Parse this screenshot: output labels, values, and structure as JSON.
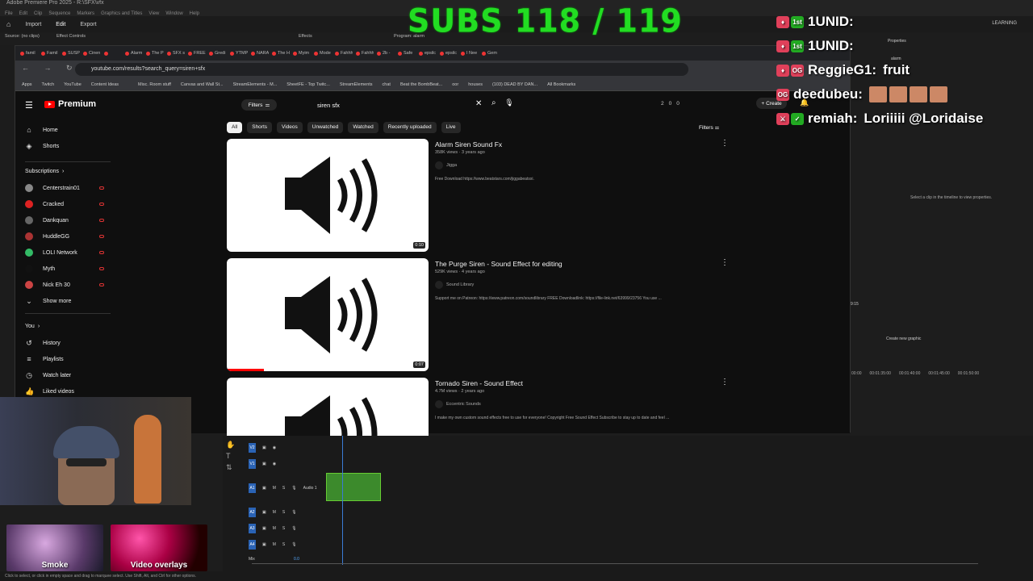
{
  "premiere": {
    "title": "Adobe Premiere Pro 2025 - R:\\SFX\\vfx",
    "menu": [
      "File",
      "Edit",
      "Clip",
      "Sequence",
      "Markers",
      "Graphics and Titles",
      "View",
      "Window",
      "Help"
    ],
    "tabs": [
      "Import",
      "Edit",
      "Export"
    ],
    "workspace": "LEARNING",
    "panels": {
      "source": "Source: (no clips)",
      "effect_controls": "Effect Controls",
      "effects": "Effects",
      "program": "Program: alarm",
      "properties": "Properties",
      "alarm": "alarm"
    },
    "properties_hint": "Select a clip in the timeline to view properties.",
    "create_graphic": "Create new graphic",
    "timecodes": [
      "00:00",
      "00:01:35:00",
      "00:01:40:00",
      "00:01:45:00",
      "00:01:50:00"
    ],
    "time_small": "9:15",
    "tracks": [
      {
        "id": "V2",
        "label": "V2"
      },
      {
        "id": "V1",
        "label": "V1"
      },
      {
        "id": "A1",
        "label": "A1",
        "name": "Audio 1"
      },
      {
        "id": "A2",
        "label": "A2"
      },
      {
        "id": "A3",
        "label": "A3"
      },
      {
        "id": "A4",
        "label": "A4"
      }
    ],
    "mix_label": "Mix",
    "mix_value": "0.0",
    "status": "Click to select, or click in empty space and drag to marquee select. Use Shift, Alt, and Ctrl for other options.",
    "effects_tiles": [
      {
        "label": "Smoke"
      },
      {
        "label": "Video overlays"
      }
    ]
  },
  "overlay": {
    "subs": "SUBS  118 / 119",
    "chat": [
      {
        "badges": [
          "gem",
          "1st"
        ],
        "user": "1UNID:",
        "text": ""
      },
      {
        "badges": [
          "gem",
          "1st"
        ],
        "user": "1UNID:",
        "text": ""
      },
      {
        "badges": [
          "gem",
          "OG"
        ],
        "user": "ReggieG1:",
        "text": "fruit"
      },
      {
        "badges": [
          "OG"
        ],
        "user": "deedubeu:",
        "text": ""
      },
      {
        "badges": [
          "sword",
          "check"
        ],
        "user": "remiah:",
        "text": "Loriiiii @Loridaise"
      }
    ]
  },
  "browser": {
    "tabs": [
      "famil",
      "Famil",
      "SUSP",
      "Cinen",
      "",
      "Alarm",
      "The P",
      "SFX s",
      "FREE",
      "Gredi",
      "YTMP",
      "NARA",
      "The H",
      "Myim",
      "Mode",
      "Fahhh",
      "Fahhh",
      "2b -",
      "Safe",
      "epsilc",
      "epsilc",
      "I Nee",
      "Gem"
    ],
    "url": "youtube.com/results?search_query=siren+sfx",
    "bookmarks": [
      "Apps",
      "Twitch",
      "YouTube",
      "Content Ideas",
      "",
      "Misc. Room stuff",
      "Canvas and Wall St...",
      "StreamElements - M...",
      "SheetFE - Top Twitc...",
      "StreamElements",
      "chat",
      "Beat the BombBeat...",
      "oor",
      "houses",
      "(103) DEAD BY DAN...",
      "All Bookmarks"
    ]
  },
  "youtube": {
    "brand": "Premium",
    "search_filter": "Filters",
    "search_query": "siren sfx",
    "top_counts": [
      "2",
      "0",
      "0"
    ],
    "create_label": "Create",
    "sidebar": {
      "home": "Home",
      "shorts": "Shorts",
      "subscriptions": "Subscriptions",
      "subs": [
        {
          "name": "Centerstrain01",
          "color": "#888"
        },
        {
          "name": "Cracked",
          "color": "#d22"
        },
        {
          "name": "Dankquan",
          "color": "#666"
        },
        {
          "name": "HuddleGG",
          "color": "#a33"
        },
        {
          "name": "LOLI Network",
          "color": "#3b6"
        },
        {
          "name": "Myth",
          "color": "#111"
        },
        {
          "name": "Nick Eh 30",
          "color": "#c44"
        }
      ],
      "show_more": "Show more",
      "you": "You",
      "history": "History",
      "playlists": "Playlists",
      "watch_later": "Watch later",
      "liked": "Liked videos"
    },
    "chips": [
      "All",
      "Shorts",
      "Videos",
      "Unwatched",
      "Watched",
      "Recently uploaded",
      "Live"
    ],
    "filters_label": "Filters",
    "videos": [
      {
        "title": "Alarm Siren Sound Fx",
        "meta": "358K views · 3 years ago",
        "channel": "Jigga",
        "desc": "Free Download https://www.beatstars.com/jiggabeatsxi.",
        "duration": "0:10"
      },
      {
        "title": "The Purge Siren - Sound Effect for editing",
        "meta": "529K views · 4 years ago",
        "channel": "Sound Library",
        "desc": "Support me on Patreon: https://www.patreon.com/soundlibrary FREE Downloadlink: https://file-link.net/63999/23756 You use ...",
        "duration": "0:07"
      },
      {
        "title": "Tornado Siren - Sound Effect",
        "meta": "4.7M views · 2 years ago",
        "channel": "Eccentric Sounds",
        "desc": "I make my own custom sound effects free to use for everyone! Copyright Free Sound Effect Subscribe to stay up to date and feel ...",
        "duration": ""
      }
    ]
  }
}
